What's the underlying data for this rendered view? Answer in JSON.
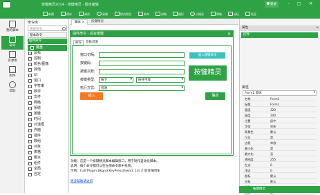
{
  "app": {
    "title": "按键精灵2014 - 按键精灵 - 脚本编辑",
    "user": "登录",
    "window_controls": [
      "-",
      "□",
      "×"
    ]
  },
  "toolbar": {
    "items": [
      "新建",
      "保存",
      "调试",
      "录制",
      "抓点抓色",
      "发布",
      "封装",
      "图形",
      "小精灵",
      "帮助",
      "论坛",
      "社区"
    ],
    "sub_tab": "按键精灵"
  },
  "leftbar": {
    "items": [
      "我的脚本",
      "命令",
      "资源库",
      "附件",
      "帮助"
    ],
    "active_index": 1
  },
  "cmdpanel": {
    "header": "命令库",
    "search_placeholder": "搜索命令",
    "groups": [
      "基本命令",
      "插件命令"
    ],
    "commands": [
      "键盘",
      "鼠标",
      "控制",
      "颜色/图像",
      "其他",
      "UI",
      "窗口",
      "字符串",
      "数学",
      "文件",
      "网络",
      "系统",
      "按键",
      "时间",
      "对话框",
      "界面",
      "插件",
      "数组",
      "对象",
      "表格",
      "脚本",
      "组件",
      "全局",
      "自定"
    ]
  },
  "editor": {
    "tab": "脚本",
    "tab_close": "×",
    "mode_label": "按键精灵",
    "footer_label": "文档",
    "help_lines": [
      "功能：这是一个按键精灵脚本编辑窗口，用于制作自动化脚本。",
      "说明：每个命令都可以在左侧命令库中找到。",
      "示例：Call Plugin.Bkgnd.KeyPress(hwnd, 13)  // 后台按回车"
    ],
    "help_link": "更多帮助请访问"
  },
  "dialog": {
    "title": "插件命令 - 后台按键",
    "close": "×",
    "tabs": [
      "命令",
      "参数说明"
    ],
    "fields": [
      {
        "label": "窗口句柄:",
        "value": ""
      },
      {
        "label": "按键码:",
        "value": ""
      },
      {
        "label": "按键次数:",
        "value": ""
      }
    ],
    "select1": {
      "label": "按键类型:",
      "value1": "按下",
      "value2": "按住不放"
    },
    "select2": {
      "label": "执行方式:",
      "value": "普通"
    },
    "side_button": "插入按键命令",
    "logo_text": "按键精灵",
    "insert_button": "插入",
    "ok_button": "确定"
  },
  "rightpanel": {
    "header": "属性",
    "header_close": "×",
    "subheader": "控件",
    "props_header": "属性",
    "props_select": "Form1 窗体",
    "props": [
      {
        "k": "名称",
        "v": "Form1"
      },
      {
        "k": "标题",
        "v": "Form1"
      },
      {
        "k": "宽度",
        "v": "320"
      },
      {
        "k": "高度",
        "v": "240"
      },
      {
        "k": "位置",
        "v": "居中"
      },
      {
        "k": "字体",
        "v": "宋体"
      },
      {
        "k": "背景色",
        "v": "默认"
      },
      {
        "k": "可见",
        "v": "是"
      },
      {
        "k": "边框",
        "v": "单线"
      },
      {
        "k": "最小化",
        "v": "是"
      },
      {
        "k": "最大化",
        "v": "否"
      },
      {
        "k": "透明度",
        "v": "255"
      },
      {
        "k": "左边",
        "v": "0"
      },
      {
        "k": "顶边",
        "v": "0"
      },
      {
        "k": "图标",
        "v": "默认"
      },
      {
        "k": "光标",
        "v": "默认"
      },
      {
        "k": "提示",
        "v": ""
      },
      {
        "k": "启用",
        "v": "是"
      }
    ],
    "status": "按键精灵"
  }
}
